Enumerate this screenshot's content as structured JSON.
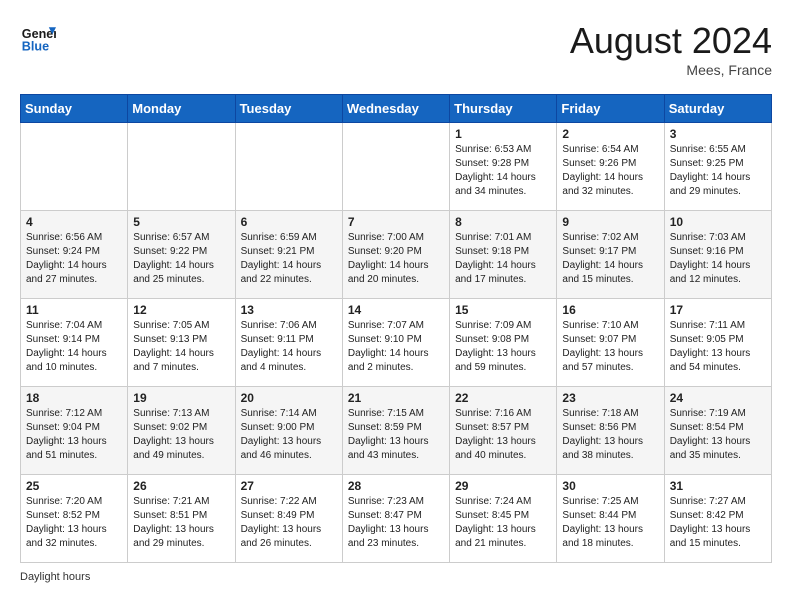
{
  "header": {
    "logo_line1": "General",
    "logo_line2": "Blue",
    "title": "August 2024",
    "subtitle": "Mees, France"
  },
  "days_of_week": [
    "Sunday",
    "Monday",
    "Tuesday",
    "Wednesday",
    "Thursday",
    "Friday",
    "Saturday"
  ],
  "weeks": [
    [
      {
        "day": "",
        "info": ""
      },
      {
        "day": "",
        "info": ""
      },
      {
        "day": "",
        "info": ""
      },
      {
        "day": "",
        "info": ""
      },
      {
        "day": "1",
        "info": "Sunrise: 6:53 AM\nSunset: 9:28 PM\nDaylight: 14 hours\nand 34 minutes."
      },
      {
        "day": "2",
        "info": "Sunrise: 6:54 AM\nSunset: 9:26 PM\nDaylight: 14 hours\nand 32 minutes."
      },
      {
        "day": "3",
        "info": "Sunrise: 6:55 AM\nSunset: 9:25 PM\nDaylight: 14 hours\nand 29 minutes."
      }
    ],
    [
      {
        "day": "4",
        "info": "Sunrise: 6:56 AM\nSunset: 9:24 PM\nDaylight: 14 hours\nand 27 minutes."
      },
      {
        "day": "5",
        "info": "Sunrise: 6:57 AM\nSunset: 9:22 PM\nDaylight: 14 hours\nand 25 minutes."
      },
      {
        "day": "6",
        "info": "Sunrise: 6:59 AM\nSunset: 9:21 PM\nDaylight: 14 hours\nand 22 minutes."
      },
      {
        "day": "7",
        "info": "Sunrise: 7:00 AM\nSunset: 9:20 PM\nDaylight: 14 hours\nand 20 minutes."
      },
      {
        "day": "8",
        "info": "Sunrise: 7:01 AM\nSunset: 9:18 PM\nDaylight: 14 hours\nand 17 minutes."
      },
      {
        "day": "9",
        "info": "Sunrise: 7:02 AM\nSunset: 9:17 PM\nDaylight: 14 hours\nand 15 minutes."
      },
      {
        "day": "10",
        "info": "Sunrise: 7:03 AM\nSunset: 9:16 PM\nDaylight: 14 hours\nand 12 minutes."
      }
    ],
    [
      {
        "day": "11",
        "info": "Sunrise: 7:04 AM\nSunset: 9:14 PM\nDaylight: 14 hours\nand 10 minutes."
      },
      {
        "day": "12",
        "info": "Sunrise: 7:05 AM\nSunset: 9:13 PM\nDaylight: 14 hours\nand 7 minutes."
      },
      {
        "day": "13",
        "info": "Sunrise: 7:06 AM\nSunset: 9:11 PM\nDaylight: 14 hours\nand 4 minutes."
      },
      {
        "day": "14",
        "info": "Sunrise: 7:07 AM\nSunset: 9:10 PM\nDaylight: 14 hours\nand 2 minutes."
      },
      {
        "day": "15",
        "info": "Sunrise: 7:09 AM\nSunset: 9:08 PM\nDaylight: 13 hours\nand 59 minutes."
      },
      {
        "day": "16",
        "info": "Sunrise: 7:10 AM\nSunset: 9:07 PM\nDaylight: 13 hours\nand 57 minutes."
      },
      {
        "day": "17",
        "info": "Sunrise: 7:11 AM\nSunset: 9:05 PM\nDaylight: 13 hours\nand 54 minutes."
      }
    ],
    [
      {
        "day": "18",
        "info": "Sunrise: 7:12 AM\nSunset: 9:04 PM\nDaylight: 13 hours\nand 51 minutes."
      },
      {
        "day": "19",
        "info": "Sunrise: 7:13 AM\nSunset: 9:02 PM\nDaylight: 13 hours\nand 49 minutes."
      },
      {
        "day": "20",
        "info": "Sunrise: 7:14 AM\nSunset: 9:00 PM\nDaylight: 13 hours\nand 46 minutes."
      },
      {
        "day": "21",
        "info": "Sunrise: 7:15 AM\nSunset: 8:59 PM\nDaylight: 13 hours\nand 43 minutes."
      },
      {
        "day": "22",
        "info": "Sunrise: 7:16 AM\nSunset: 8:57 PM\nDaylight: 13 hours\nand 40 minutes."
      },
      {
        "day": "23",
        "info": "Sunrise: 7:18 AM\nSunset: 8:56 PM\nDaylight: 13 hours\nand 38 minutes."
      },
      {
        "day": "24",
        "info": "Sunrise: 7:19 AM\nSunset: 8:54 PM\nDaylight: 13 hours\nand 35 minutes."
      }
    ],
    [
      {
        "day": "25",
        "info": "Sunrise: 7:20 AM\nSunset: 8:52 PM\nDaylight: 13 hours\nand 32 minutes."
      },
      {
        "day": "26",
        "info": "Sunrise: 7:21 AM\nSunset: 8:51 PM\nDaylight: 13 hours\nand 29 minutes."
      },
      {
        "day": "27",
        "info": "Sunrise: 7:22 AM\nSunset: 8:49 PM\nDaylight: 13 hours\nand 26 minutes."
      },
      {
        "day": "28",
        "info": "Sunrise: 7:23 AM\nSunset: 8:47 PM\nDaylight: 13 hours\nand 23 minutes."
      },
      {
        "day": "29",
        "info": "Sunrise: 7:24 AM\nSunset: 8:45 PM\nDaylight: 13 hours\nand 21 minutes."
      },
      {
        "day": "30",
        "info": "Sunrise: 7:25 AM\nSunset: 8:44 PM\nDaylight: 13 hours\nand 18 minutes."
      },
      {
        "day": "31",
        "info": "Sunrise: 7:27 AM\nSunset: 8:42 PM\nDaylight: 13 hours\nand 15 minutes."
      }
    ]
  ],
  "footer": {
    "note": "Daylight hours"
  }
}
